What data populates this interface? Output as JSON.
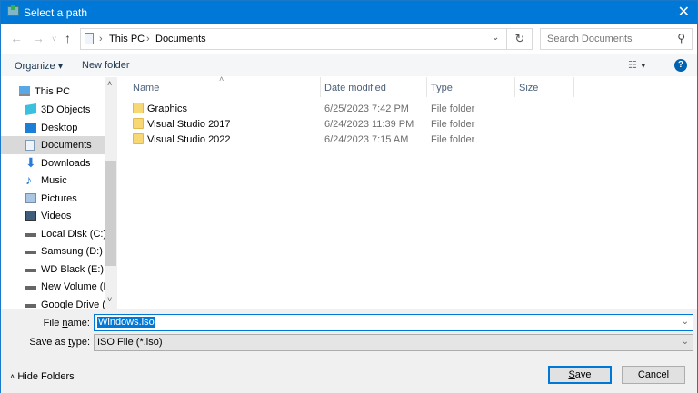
{
  "window": {
    "title": "Select a path",
    "close_icon": "close-icon"
  },
  "nav": {
    "path": [
      "This PC",
      "Documents"
    ],
    "search_placeholder": "Search Documents"
  },
  "toolbar": {
    "organize": "Organize ▾",
    "new_folder": "New folder",
    "help": "?"
  },
  "sidebar": {
    "items": [
      {
        "label": "This PC",
        "icon": "computer-icon"
      },
      {
        "label": "3D Objects",
        "icon": "cube-icon"
      },
      {
        "label": "Desktop",
        "icon": "desktop-icon"
      },
      {
        "label": "Documents",
        "icon": "document-icon",
        "selected": true
      },
      {
        "label": "Downloads",
        "icon": "download-arrow-icon"
      },
      {
        "label": "Music",
        "icon": "music-note-icon"
      },
      {
        "label": "Pictures",
        "icon": "picture-icon"
      },
      {
        "label": "Videos",
        "icon": "film-icon"
      },
      {
        "label": "Local Disk (C:)",
        "icon": "drive-icon"
      },
      {
        "label": "Samsung (D:)",
        "icon": "drive-icon"
      },
      {
        "label": "WD Black (E:)",
        "icon": "drive-icon"
      },
      {
        "label": "New Volume (F:)",
        "icon": "drive-icon"
      },
      {
        "label": "Google Drive (G:",
        "icon": "drive-icon"
      }
    ]
  },
  "list": {
    "columns": [
      "Name",
      "Date modified",
      "Type",
      "Size"
    ],
    "rows": [
      {
        "name": "Graphics",
        "date": "6/25/2023 7:42 PM",
        "type": "File folder",
        "size": ""
      },
      {
        "name": "Visual Studio 2017",
        "date": "6/24/2023 11:39 PM",
        "type": "File folder",
        "size": ""
      },
      {
        "name": "Visual Studio 2022",
        "date": "6/24/2023 7:15 AM",
        "type": "File folder",
        "size": ""
      }
    ]
  },
  "bottom": {
    "file_name_label_pre": "File ",
    "file_name_label_u": "n",
    "file_name_label_post": "ame:",
    "file_name_value": "Windows.iso",
    "save_type_label_pre": "Save as ",
    "save_type_label_u": "t",
    "save_type_label_post": "ype:",
    "save_type_value": "ISO File (*.iso)",
    "hide_folders": "Hide Folders",
    "save_u": "S",
    "save_rest": "ave",
    "cancel": "Cancel"
  },
  "colors": {
    "titlebar": "#0078d7",
    "selection": "#d9d9d9",
    "folder": "#f8d775"
  }
}
